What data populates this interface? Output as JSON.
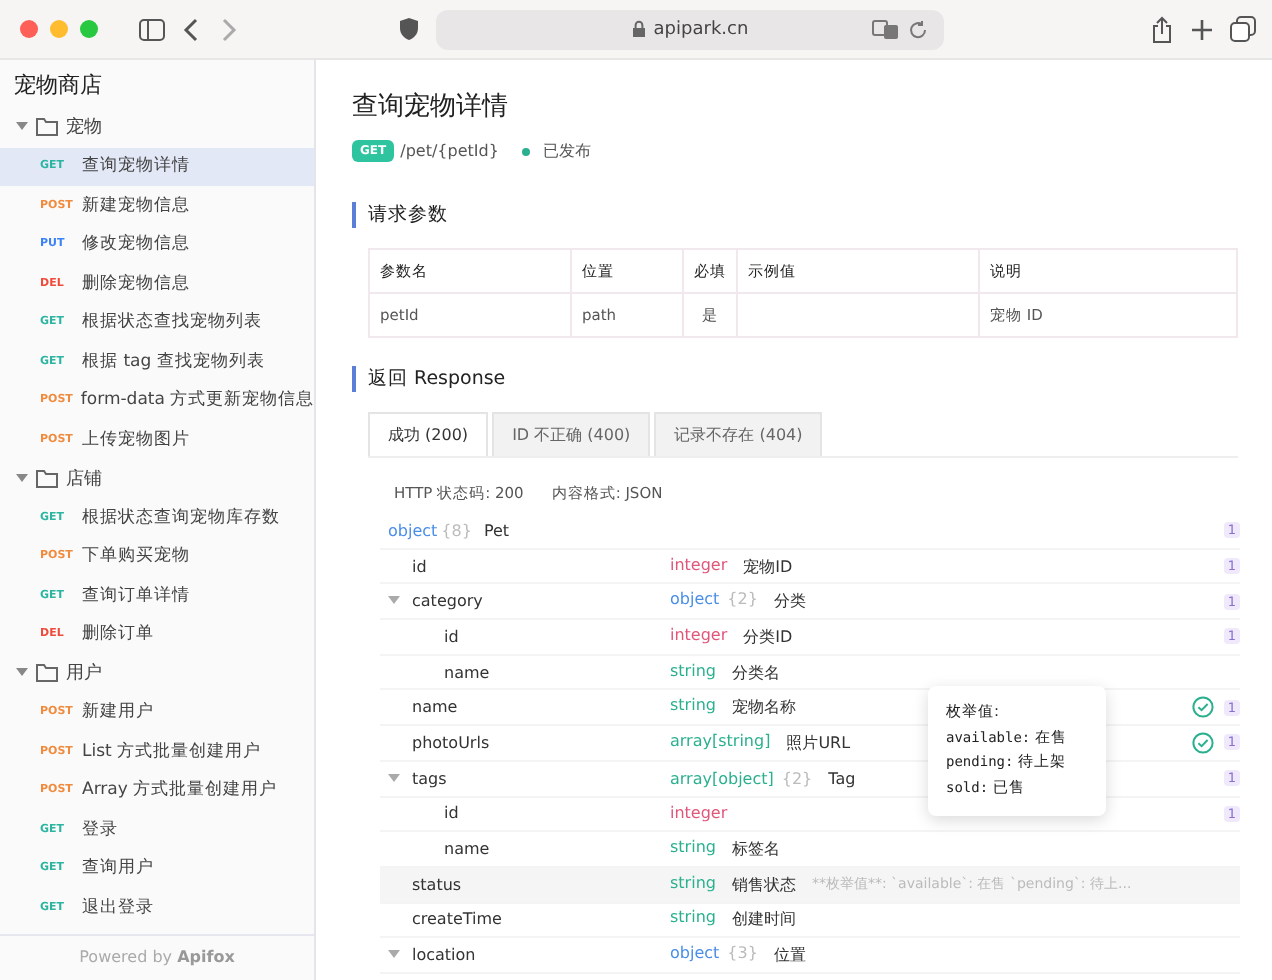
{
  "browser": {
    "url": "apipark.cn"
  },
  "sidebar": {
    "title": "宠物商店",
    "groups": [
      {
        "name": "宠物",
        "expanded": true,
        "items": [
          {
            "method": "GET",
            "color": "#2bb5a0",
            "label": "查询宠物详情",
            "selected": true
          },
          {
            "method": "POST",
            "color": "#f08a3c",
            "label": "新建宠物信息",
            "selected": false
          },
          {
            "method": "PUT",
            "color": "#3b82f6",
            "label": "修改宠物信息",
            "selected": false
          },
          {
            "method": "DEL",
            "color": "#ef4b3a",
            "label": "删除宠物信息",
            "selected": false
          },
          {
            "method": "GET",
            "color": "#2bb5a0",
            "label": "根据状态查找宠物列表",
            "selected": false
          },
          {
            "method": "GET",
            "color": "#2bb5a0",
            "label": "根据 tag 查找宠物列表",
            "selected": false
          },
          {
            "method": "POST",
            "color": "#f08a3c",
            "label": "form-data 方式更新宠物信息",
            "selected": false
          },
          {
            "method": "POST",
            "color": "#f08a3c",
            "label": "上传宠物图片",
            "selected": false
          }
        ]
      },
      {
        "name": "店铺",
        "expanded": true,
        "items": [
          {
            "method": "GET",
            "color": "#2bb5a0",
            "label": "根据状态查询宠物库存数",
            "selected": false
          },
          {
            "method": "POST",
            "color": "#f08a3c",
            "label": "下单购买宠物",
            "selected": false
          },
          {
            "method": "GET",
            "color": "#2bb5a0",
            "label": "查询订单详情",
            "selected": false
          },
          {
            "method": "DEL",
            "color": "#ef4b3a",
            "label": "删除订单",
            "selected": false
          }
        ]
      },
      {
        "name": "用户",
        "expanded": true,
        "items": [
          {
            "method": "POST",
            "color": "#f08a3c",
            "label": "新建用户",
            "selected": false
          },
          {
            "method": "POST",
            "color": "#f08a3c",
            "label": "List 方式批量创建用户",
            "selected": false
          },
          {
            "method": "POST",
            "color": "#f08a3c",
            "label": "Array 方式批量创建用户",
            "selected": false
          },
          {
            "method": "GET",
            "color": "#2bb5a0",
            "label": "登录",
            "selected": false
          },
          {
            "method": "GET",
            "color": "#2bb5a0",
            "label": "查询用户",
            "selected": false
          },
          {
            "method": "GET",
            "color": "#2bb5a0",
            "label": "退出登录",
            "selected": false
          }
        ]
      }
    ],
    "footer_prefix": "Powered by",
    "footer_brand": "Apifox"
  },
  "page": {
    "title": "查询宠物详情",
    "method": "GET",
    "path": "/pet/{petId}",
    "status": "已发布"
  },
  "request": {
    "heading": "请求参数",
    "columns": [
      "参数名",
      "位置",
      "必填",
      "示例值",
      "说明"
    ],
    "rows": [
      [
        "petId",
        "path",
        "是",
        "",
        "宠物 ID"
      ]
    ]
  },
  "response": {
    "heading": "返回 Response",
    "tabs": [
      {
        "label": "成功 (200)",
        "selected": true
      },
      {
        "label": "ID 不正确 (400)",
        "selected": false
      },
      {
        "label": "记录不存在 (404)",
        "selected": false
      }
    ],
    "status_code": "HTTP 状态码: 200",
    "content_type": "内容格式: JSON",
    "root": {
      "type": "object",
      "count": "{8}",
      "desc": "Pet",
      "badge": "1"
    },
    "fields": [
      {
        "name": "id",
        "kind": "integer",
        "type": "integer",
        "desc": "宠物ID",
        "badge": "1"
      },
      {
        "name": "category",
        "kind": "object",
        "type": "object",
        "count": "{2}",
        "desc": "分类",
        "badge": "1",
        "expanded": true,
        "children": [
          {
            "name": "id",
            "kind": "integer",
            "type": "integer",
            "desc": "分类ID",
            "badge": "1"
          },
          {
            "name": "name",
            "kind": "string",
            "type": "string",
            "desc": "分类名"
          }
        ]
      },
      {
        "name": "name",
        "kind": "string",
        "type": "string",
        "desc": "宠物名称",
        "badge": "1",
        "required": true
      },
      {
        "name": "photoUrls",
        "kind": "array",
        "type": "array[string]",
        "desc": "照片URL",
        "badge": "1",
        "required": true
      },
      {
        "name": "tags",
        "kind": "array",
        "type": "array[object]",
        "count": "{2}",
        "desc": "Tag",
        "badge": "1",
        "expanded": true,
        "children": [
          {
            "name": "id",
            "kind": "integer",
            "type": "integer",
            "badge": "1"
          },
          {
            "name": "name",
            "kind": "string",
            "type": "string",
            "desc": "标签名"
          }
        ]
      },
      {
        "name": "status",
        "kind": "string",
        "type": "string",
        "desc": "销售状态",
        "note": "**枚举值**: `available`: 在售 `pending`: 待上...",
        "highlighted": true
      },
      {
        "name": "createTime",
        "kind": "string",
        "type": "string",
        "desc": "创建时间"
      },
      {
        "name": "location",
        "kind": "object",
        "type": "object",
        "count": "{3}",
        "desc": "位置",
        "expanded": true
      }
    ],
    "tooltip": {
      "title": "枚举值:",
      "lines": [
        {
          "key": "available:",
          "value": "在售"
        },
        {
          "key": "pending:",
          "value": "待上架"
        },
        {
          "key": "sold:",
          "value": "已售"
        }
      ]
    }
  }
}
